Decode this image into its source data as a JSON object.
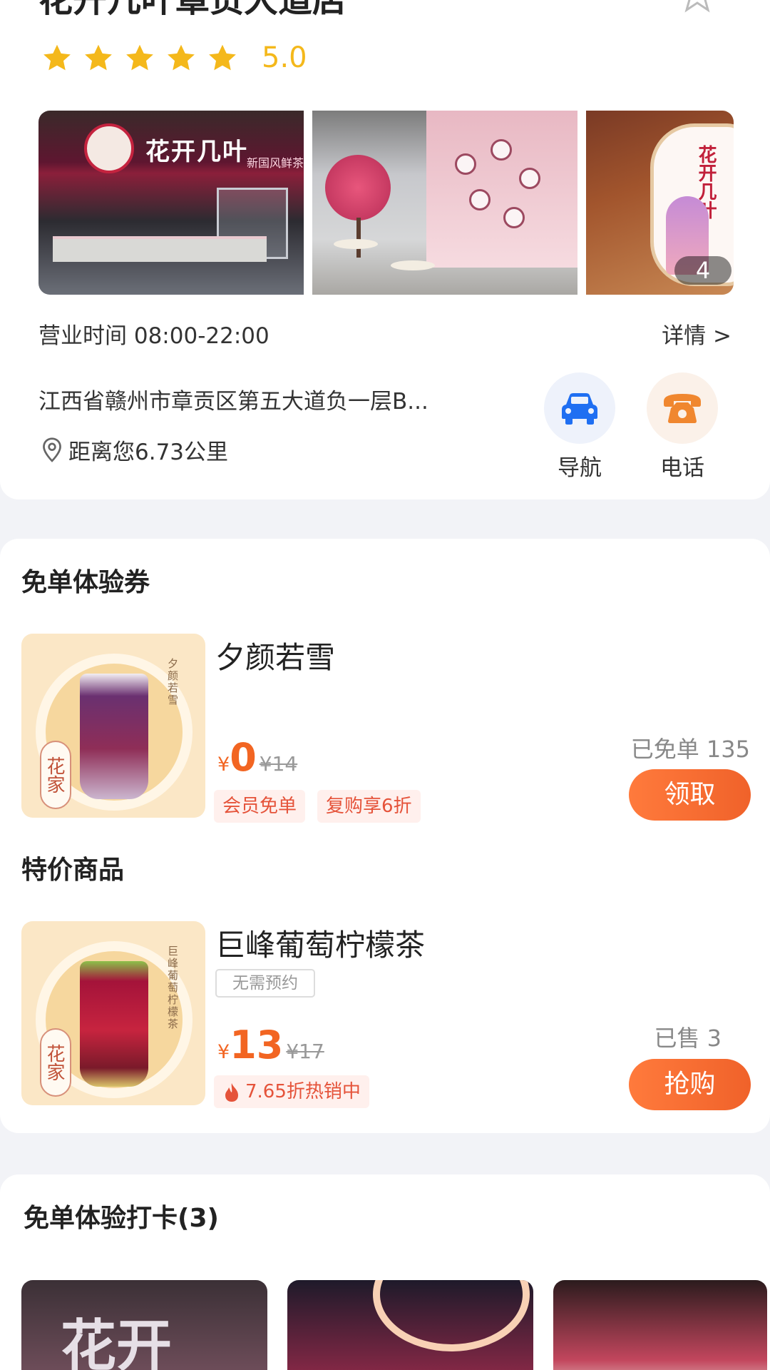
{
  "store": {
    "name": "花开几叶章贡大道店",
    "rating": "5.0",
    "photos": {
      "sign_text": "花开几叶",
      "sign_sub": "新国风鲜茶",
      "photo3_text": "花开几叶",
      "count": "4"
    },
    "hours": "营业时间  08:00-22:00",
    "details_label": "详情 >",
    "address": "江西省赣州市章贡区第五大道负一层B...",
    "distance": "距离您6.73公里",
    "actions": {
      "navigate": "导航",
      "call": "电话"
    }
  },
  "colors": {
    "accent": "#f26522",
    "star": "#f4b81b",
    "nav_icon": "#1f6ff2",
    "phone_icon": "#f0872f"
  },
  "coupons": {
    "section_title": "免单体验券",
    "items": [
      {
        "name": "夕颜若雪",
        "image_text": "夕颜若雪",
        "seal": "花家",
        "currency": "¥",
        "price": "0",
        "original": "¥14",
        "tags": [
          "会员免单",
          "复购享6折"
        ],
        "sold": "已免单 135",
        "button": "领取"
      }
    ]
  },
  "deals": {
    "section_title": "特价商品",
    "items": [
      {
        "name": "巨峰葡萄柠檬茶",
        "image_text": "巨峰葡萄柠檬茶",
        "seal": "花家",
        "badge": "无需预约",
        "currency": "¥",
        "price": "13",
        "original": "¥17",
        "promo": "7.65折热销中",
        "sold": "已售 3",
        "button": "抢购"
      }
    ]
  },
  "checkins": {
    "section_title": "免单体验打卡(3)",
    "thumb_text": "花开"
  }
}
